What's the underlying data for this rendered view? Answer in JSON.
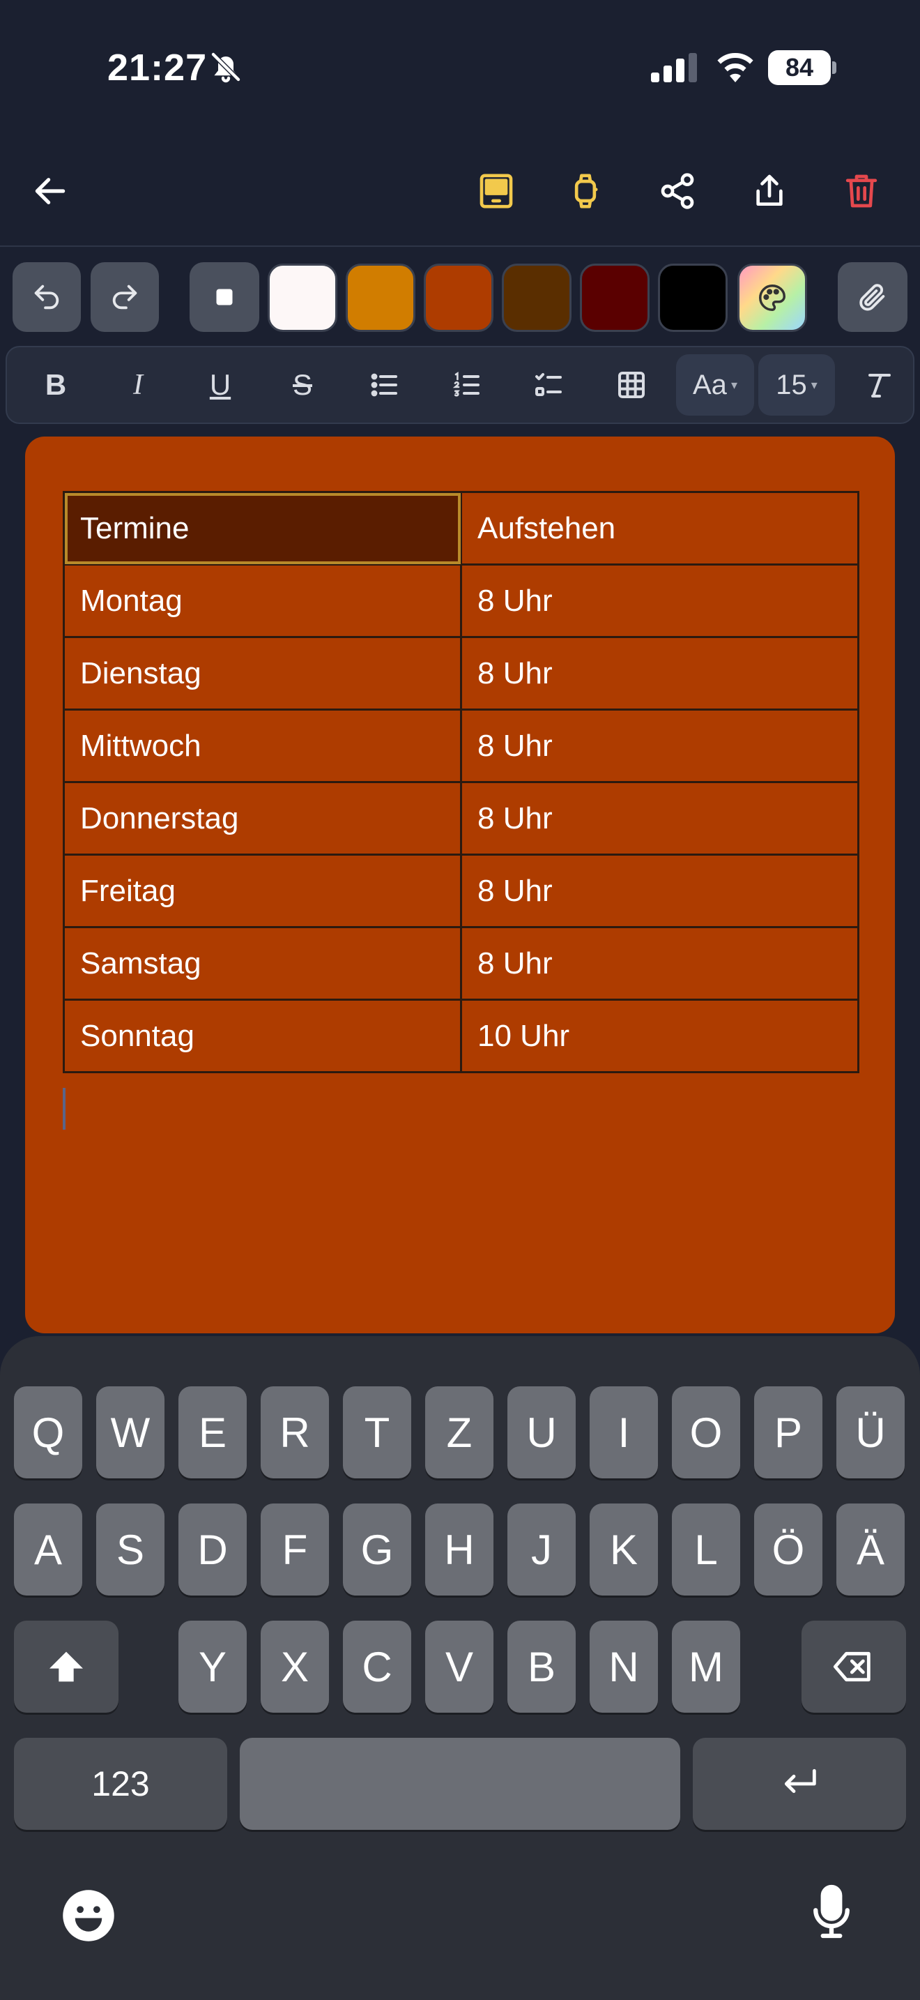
{
  "status_bar": {
    "time": "21:27",
    "battery": "84"
  },
  "header": {
    "icons": [
      "back-arrow-icon",
      "tablet-icon",
      "watch-icon",
      "share-nodes-icon",
      "export-icon",
      "trash-icon"
    ],
    "accent_color": "#f2c94c",
    "delete_color": "#e5484d"
  },
  "color_toolbar": {
    "swatches": [
      {
        "name": "white",
        "color": "#fdf7f7"
      },
      {
        "name": "orange",
        "color": "#d17d00"
      },
      {
        "name": "rust",
        "color": "#ae3c00"
      },
      {
        "name": "brown",
        "color": "#5a2e00"
      },
      {
        "name": "maroon",
        "color": "#5a0000"
      },
      {
        "name": "black",
        "color": "#000000"
      }
    ]
  },
  "format_toolbar": {
    "bold": "B",
    "italic": "I",
    "underline": "U",
    "strike": "S",
    "font_style": "Aa",
    "font_size": "15"
  },
  "note": {
    "background": "#ae3c00",
    "table": {
      "header": [
        "Termine",
        "Aufstehen"
      ],
      "rows": [
        [
          "Montag",
          "8 Uhr"
        ],
        [
          "Dienstag",
          "8 Uhr"
        ],
        [
          "Mittwoch",
          "8 Uhr"
        ],
        [
          "Donnerstag",
          "8 Uhr"
        ],
        [
          "Freitag",
          "8 Uhr"
        ],
        [
          "Samstag",
          "8 Uhr"
        ],
        [
          "Sonntag",
          "10 Uhr"
        ]
      ]
    }
  },
  "keyboard": {
    "row1": [
      "Q",
      "W",
      "E",
      "R",
      "T",
      "Z",
      "U",
      "I",
      "O",
      "P",
      "Ü"
    ],
    "row2": [
      "A",
      "S",
      "D",
      "F",
      "G",
      "H",
      "J",
      "K",
      "L",
      "Ö",
      "Ä"
    ],
    "row3": [
      "Y",
      "X",
      "C",
      "V",
      "B",
      "N",
      "M"
    ],
    "numbers_label": "123"
  }
}
